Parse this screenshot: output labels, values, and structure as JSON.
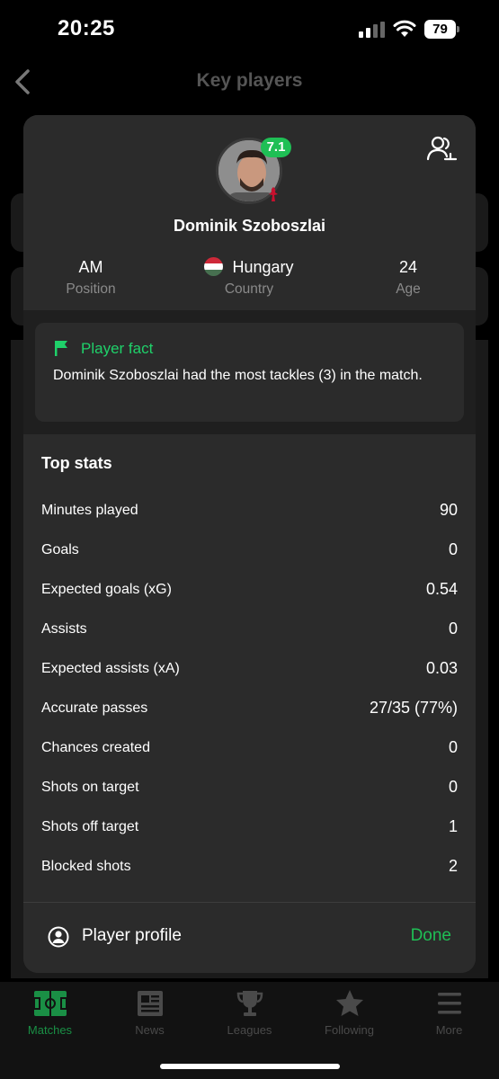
{
  "status_bar": {
    "time": "20:25",
    "battery": "79"
  },
  "header": {
    "title": "Key players"
  },
  "player": {
    "name": "Dominik Szoboszlai",
    "rating": "7.1",
    "position_value": "AM",
    "position_label": "Position",
    "country_value": "Hungary",
    "country_label": "Country",
    "age_value": "24",
    "age_label": "Age"
  },
  "fact": {
    "title": "Player fact",
    "text": "Dominik Szoboszlai had the most tackles (3) in the match."
  },
  "stats": {
    "title": "Top stats",
    "rows": [
      {
        "label": "Minutes played",
        "value": "90"
      },
      {
        "label": "Goals",
        "value": "0"
      },
      {
        "label": "Expected goals (xG)",
        "value": "0.54"
      },
      {
        "label": "Assists",
        "value": "0"
      },
      {
        "label": "Expected assists (xA)",
        "value": "0.03"
      },
      {
        "label": "Accurate passes",
        "value": "27/35 (77%)"
      },
      {
        "label": "Chances created",
        "value": "0"
      },
      {
        "label": "Shots on target",
        "value": "0"
      },
      {
        "label": "Shots off target",
        "value": "1"
      },
      {
        "label": "Blocked shots",
        "value": "2"
      }
    ]
  },
  "footer": {
    "profile_label": "Player profile",
    "done_label": "Done"
  },
  "nav": {
    "items": [
      {
        "label": "Matches",
        "icon": "pitch-icon"
      },
      {
        "label": "News",
        "icon": "news-icon"
      },
      {
        "label": "Leagues",
        "icon": "trophy-icon"
      },
      {
        "label": "Following",
        "icon": "star-icon"
      },
      {
        "label": "More",
        "icon": "menu-icon"
      }
    ]
  },
  "colors": {
    "accent": "#1fbf55",
    "modal_bg": "#2b2b2b",
    "fact_accent": "#1fd16a"
  }
}
